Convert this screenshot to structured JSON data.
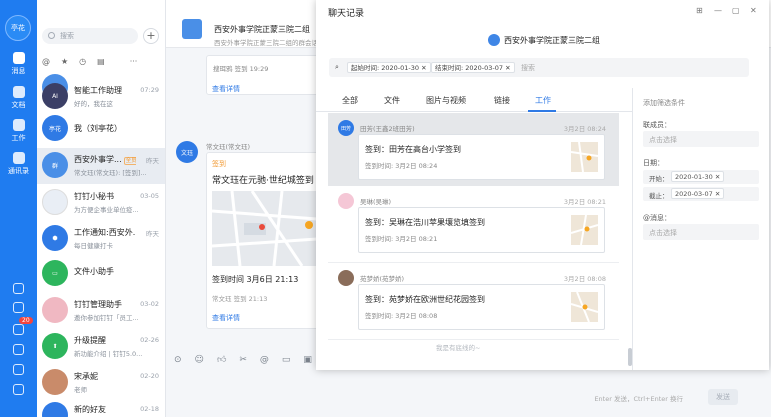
{
  "user": {
    "name": "亭花"
  },
  "rail": {
    "items": [
      {
        "label": "消息",
        "icon": "message-icon",
        "active": true
      },
      {
        "label": "文档",
        "icon": "document-icon"
      },
      {
        "label": "工作",
        "icon": "work-icon"
      },
      {
        "label": "通讯录",
        "icon": "contacts-icon"
      }
    ],
    "badge": "20"
  },
  "list": {
    "search_placeholder": "搜索",
    "add": "+",
    "conversations": [
      {
        "name": "",
        "preview": "",
        "time": ""
      },
      {
        "name": "智能工作助理",
        "preview": "好的，我在这",
        "time": "07:29"
      },
      {
        "name": "我（刘亭花）",
        "preview": "",
        "time": ""
      },
      {
        "name": "西安外事学...",
        "tag": "全员",
        "preview": "常文珏(常文珏): [签到]...",
        "time": "昨天"
      },
      {
        "name": "钉钉小秘书",
        "preview": "为方便企事业单位疫...",
        "time": "03-05"
      },
      {
        "name": "工作通知:西安外...",
        "preview": "每日健康打卡",
        "time": "昨天"
      },
      {
        "name": "文件小助手",
        "preview": "",
        "time": ""
      },
      {
        "name": "钉钉管理助手",
        "preview": "邀你参加钉钉「员工...",
        "time": "03-02"
      },
      {
        "name": "升级提醒",
        "preview": "新功能介绍 | 钉钉5.0...",
        "time": "02-26"
      },
      {
        "name": "宋承妮",
        "preview": "老师",
        "time": "02-20"
      },
      {
        "name": "新的好友",
        "preview": "",
        "time": "02-18"
      }
    ]
  },
  "chat": {
    "title": "西安外事学院正蒙三院二组",
    "subtitle": "西安外事学院正蒙三院二组的群会话",
    "top_card_text": "搜珥鸦 签到 19:29",
    "top_card_link": "查看详情",
    "sender": "常文珏(常文珏)",
    "sender_avatar": "文珏",
    "card_tag": "签到",
    "card_title": "常文珏在元驰·世纪城签到",
    "card_time": "签到时间 3月6日 21:13",
    "card_sub": "常文珏 签到 21:13",
    "card_link": "查看详情",
    "input_hint": "Enter 发送，Ctrl+Enter 换行",
    "send_label": "发送"
  },
  "modal": {
    "title": "聊天记录",
    "group_name": "西安外事学院正蒙三院二组",
    "filters": {
      "start": "起始时间: 2020-01-30",
      "end": "结束时间: 2020-03-07",
      "search_placeholder": "搜索"
    },
    "tabs": [
      "全部",
      "文件",
      "图片与视频",
      "链接",
      "工作"
    ],
    "active_tab": "工作",
    "results": [
      {
        "name": "田芳(王鑫2班田芳)",
        "avatar": "田芳",
        "time": "3月2日 08:24",
        "title": "签到：田芳在高台小学签到",
        "sub": "签到时间: 3月2日 08:24"
      },
      {
        "name": "吴琳(吴琳)",
        "avatar": "",
        "time": "3月2日 08:21",
        "title": "签到：吴琳在浩川苹果壤览填签到",
        "sub": "签到时间: 3月2日 08:21"
      },
      {
        "name": "苑梦娇(苑梦娇)",
        "avatar": "",
        "time": "3月2日 08:08",
        "title": "签到：苑梦娇在欧洲世纪花园签到",
        "sub": "签到时间: 3月2日 08:08"
      }
    ],
    "no_more": "我是有底线的~",
    "right": {
      "heading": "添加筛选条件",
      "member_label": "联成员：",
      "member_placeholder": "点击选择",
      "date_label": "日期：",
      "start_label": "开始：",
      "start_value": "2020-01-30",
      "end_label": "截止：",
      "end_value": "2020-03-07",
      "mention_label": "@消息：",
      "mention_placeholder": "点击选择"
    }
  },
  "colors": {
    "rail": "#1f7cf0",
    "accent": "#2f7ae5"
  }
}
